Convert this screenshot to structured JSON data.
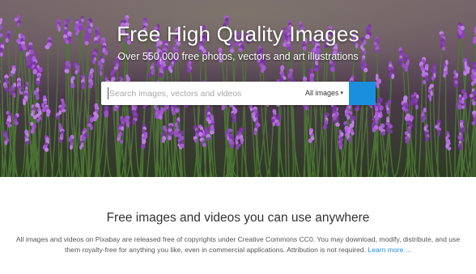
{
  "hero": {
    "title": "Free High Quality Images",
    "subtitle": "Over 550,000 free photos, vectors and art illustrations",
    "search": {
      "placeholder": "Search images, vectors and videos",
      "media_type": "All images",
      "submit_icon": "search-icon"
    },
    "background_colors": {
      "sky": "#6e5b64",
      "flowers": "#9b4fc8",
      "stems": "#3f6b2e"
    }
  },
  "intro": {
    "heading": "Free images and videos you can use anywhere",
    "text": "All images and videos on Pixabay are released free of copyrights under Creative Commons CC0. You may download, modify, distribute, and use them royalty-free for anything you like, even in commercial applications. Attribution is not required.",
    "learn_more": "Learn more ..."
  },
  "colors": {
    "accent": "#1a8fde",
    "heading_text": "#333333",
    "body_text": "#555555"
  }
}
